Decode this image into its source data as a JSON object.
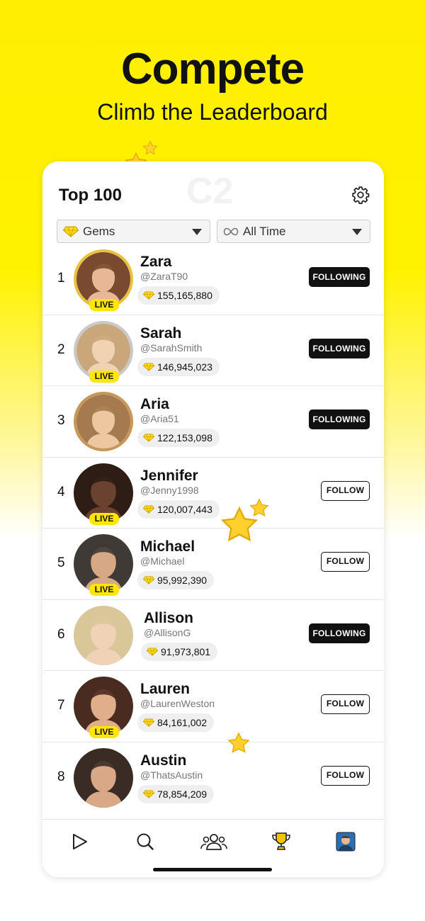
{
  "hero": {
    "title": "Compete",
    "subtitle": "Climb the Leaderboard"
  },
  "card": {
    "title": "Top 100",
    "watermark": "C2",
    "filters": {
      "metric": "Gems",
      "period": "All Time"
    }
  },
  "leaderboard": [
    {
      "rank": "1",
      "name": "Zara",
      "handle": "@ZaraT90",
      "gems": "155,165,880",
      "button": "FOLLOWING",
      "live": "LIVE",
      "frame": "gold"
    },
    {
      "rank": "2",
      "name": "Sarah",
      "handle": "@SarahSmith",
      "gems": "146,945,023",
      "button": "FOLLOWING",
      "live": "LIVE",
      "frame": "silver"
    },
    {
      "rank": "3",
      "name": "Aria",
      "handle": "@Aria51",
      "gems": "122,153,098",
      "button": "FOLLOWING",
      "live": "",
      "frame": "bronze"
    },
    {
      "rank": "4",
      "name": "Jennifer",
      "handle": "@Jenny1998",
      "gems": "120,007,443",
      "button": "FOLLOW",
      "live": "LIVE",
      "frame": "none"
    },
    {
      "rank": "5",
      "name": "Michael",
      "handle": "@Michael",
      "gems": "95,992,390",
      "button": "FOLLOW",
      "live": "LIVE",
      "frame": "none"
    },
    {
      "rank": "6",
      "name": "Allison",
      "handle": "@AllisonG",
      "gems": "91,973,801",
      "button": "FOLLOWING",
      "live": "",
      "frame": "none"
    },
    {
      "rank": "7",
      "name": "Lauren",
      "handle": "@LaurenWeston",
      "gems": "84,161,002",
      "button": "FOLLOW",
      "live": "LIVE",
      "frame": "none"
    },
    {
      "rank": "8",
      "name": "Austin",
      "handle": "@ThatsAustin",
      "gems": "78,854,209",
      "button": "FOLLOW",
      "live": "",
      "frame": "none"
    }
  ],
  "tabbar": {
    "items": [
      "play-icon",
      "search-icon",
      "people-icon",
      "trophy-icon",
      "profile-avatar"
    ],
    "active": "trophy-icon"
  },
  "colors": {
    "brand_yellow": "#ffee00",
    "following_bg": "#111111",
    "live_badge": "#ffe600",
    "active_tab": "#f5c400"
  }
}
